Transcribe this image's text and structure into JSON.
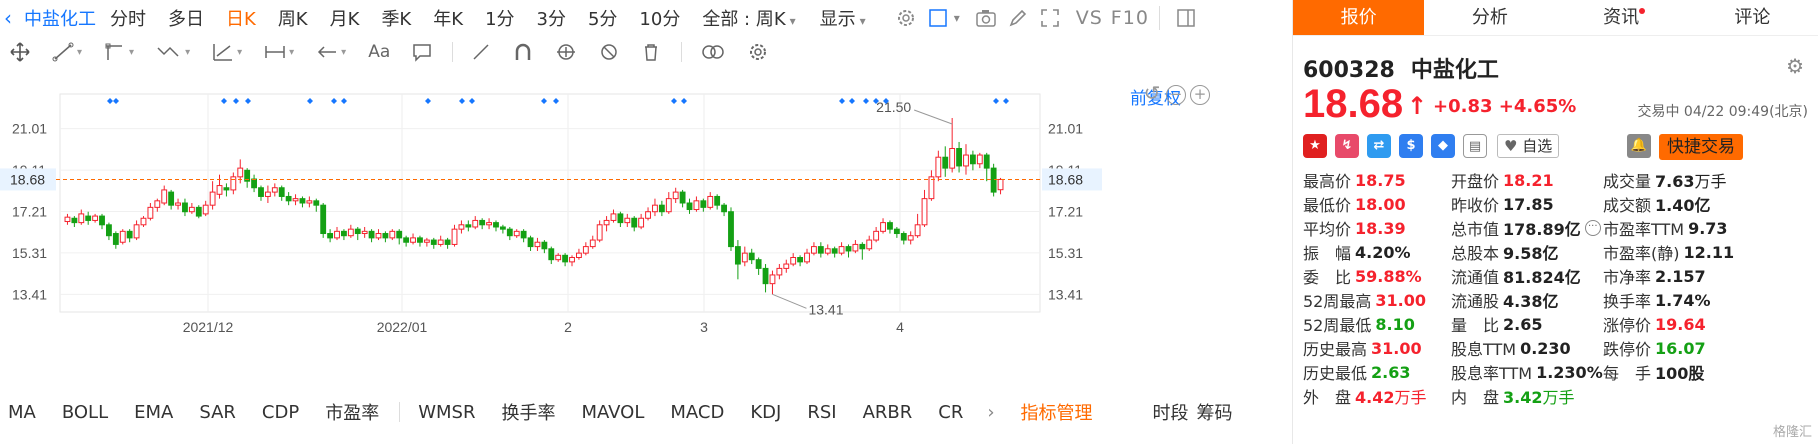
{
  "toolbar": {
    "stock_name": "中盐化工",
    "periods": [
      "分时",
      "多日",
      "日K",
      "周K",
      "月K",
      "季K",
      "年K",
      "1分",
      "3分",
      "5分",
      "10分"
    ],
    "active_period": "日K",
    "range_select": "全部 : 周K",
    "display_label": "显示",
    "vs_label": "VS",
    "f10_label": "F10"
  },
  "chart": {
    "adjust_label": "前复权",
    "current_price_label": "18.68",
    "y_ticks": [
      "21.01",
      "19.11",
      "18.68",
      "17.21",
      "15.31",
      "13.41"
    ],
    "x_labels": [
      "2021/12",
      "2022/01",
      "2",
      "3",
      "4"
    ],
    "max_annotation": "21.50",
    "min_annotation": "13.41",
    "colors": {
      "up": "#f5222d",
      "down": "#14a014",
      "marker": "#1677ff",
      "price_line": "#ff6a00"
    }
  },
  "chart_data": {
    "type": "candlestick",
    "ylim": [
      12.6,
      22.6
    ],
    "x_labels": [
      "2021/12",
      "2022/01",
      "2",
      "3",
      "4"
    ],
    "candles": [
      [
        16.75,
        16.95,
        16.6,
        17.1
      ],
      [
        16.9,
        16.7,
        16.5,
        17.0
      ],
      [
        16.7,
        17.1,
        16.6,
        17.3
      ],
      [
        17.0,
        16.8,
        16.6,
        17.2
      ],
      [
        16.8,
        17.0,
        16.7,
        17.1
      ],
      [
        17.0,
        16.6,
        16.4,
        17.1
      ],
      [
        16.6,
        16.1,
        15.9,
        16.7
      ],
      [
        16.2,
        15.7,
        15.5,
        16.3
      ],
      [
        15.8,
        16.3,
        15.7,
        16.4
      ],
      [
        16.3,
        16.0,
        15.8,
        16.4
      ],
      [
        16.0,
        16.6,
        15.9,
        16.8
      ],
      [
        16.6,
        16.9,
        16.5,
        17.0
      ],
      [
        16.9,
        17.4,
        16.8,
        17.6
      ],
      [
        17.4,
        17.7,
        17.2,
        17.8
      ],
      [
        17.6,
        18.2,
        17.5,
        18.4
      ],
      [
        18.1,
        17.5,
        17.3,
        18.2
      ],
      [
        17.5,
        17.6,
        17.3,
        17.8
      ],
      [
        17.6,
        17.2,
        17.0,
        17.8
      ],
      [
        17.2,
        17.4,
        17.1,
        17.6
      ],
      [
        17.4,
        17.0,
        16.9,
        17.5
      ],
      [
        17.1,
        17.5,
        17.0,
        17.7
      ],
      [
        17.5,
        18.1,
        17.3,
        18.6
      ],
      [
        18.0,
        18.4,
        17.8,
        18.9
      ],
      [
        18.3,
        18.2,
        17.9,
        18.5
      ],
      [
        18.2,
        18.8,
        18.0,
        19.0
      ],
      [
        18.8,
        19.2,
        18.5,
        19.6
      ],
      [
        19.1,
        18.6,
        18.3,
        19.2
      ],
      [
        18.7,
        18.3,
        18.1,
        18.9
      ],
      [
        18.3,
        17.9,
        17.7,
        18.4
      ],
      [
        17.9,
        18.1,
        17.6,
        18.4
      ],
      [
        18.1,
        18.3,
        17.9,
        18.5
      ],
      [
        18.3,
        17.9,
        17.7,
        18.4
      ],
      [
        17.9,
        17.7,
        17.5,
        18.1
      ],
      [
        17.7,
        17.8,
        17.5,
        18.0
      ],
      [
        17.8,
        17.6,
        17.4,
        17.9
      ],
      [
        17.6,
        17.7,
        17.4,
        17.9
      ],
      [
        17.7,
        17.5,
        17.2,
        17.8
      ],
      [
        17.5,
        16.2,
        16.0,
        17.6
      ],
      [
        16.2,
        16.0,
        15.8,
        16.4
      ],
      [
        16.0,
        16.3,
        15.9,
        16.5
      ],
      [
        16.3,
        16.1,
        15.9,
        16.4
      ],
      [
        16.1,
        16.4,
        16.0,
        16.6
      ],
      [
        16.4,
        16.2,
        15.9,
        16.5
      ],
      [
        16.2,
        16.3,
        16.0,
        16.5
      ],
      [
        16.3,
        16.0,
        15.8,
        16.4
      ],
      [
        16.0,
        16.2,
        15.9,
        16.4
      ],
      [
        16.2,
        16.0,
        15.8,
        16.3
      ],
      [
        16.0,
        16.3,
        15.9,
        16.4
      ],
      [
        16.3,
        16.0,
        15.7,
        16.4
      ],
      [
        16.0,
        15.8,
        15.6,
        16.1
      ],
      [
        15.8,
        16.0,
        15.7,
        16.2
      ],
      [
        16.0,
        15.8,
        15.6,
        16.1
      ],
      [
        15.8,
        15.9,
        15.6,
        16.0
      ],
      [
        15.9,
        15.7,
        15.5,
        16.0
      ],
      [
        15.7,
        15.9,
        15.6,
        16.1
      ],
      [
        15.9,
        15.7,
        15.5,
        16.0
      ],
      [
        15.7,
        16.4,
        15.6,
        16.6
      ],
      [
        16.4,
        16.6,
        16.2,
        16.8
      ],
      [
        16.6,
        16.5,
        16.3,
        16.8
      ],
      [
        16.5,
        16.8,
        16.4,
        17.0
      ],
      [
        16.8,
        16.6,
        16.4,
        16.9
      ],
      [
        16.6,
        16.7,
        16.4,
        16.9
      ],
      [
        16.7,
        16.5,
        16.3,
        16.8
      ],
      [
        16.5,
        16.4,
        16.2,
        16.6
      ],
      [
        16.4,
        16.1,
        15.9,
        16.5
      ],
      [
        16.1,
        16.3,
        16.0,
        16.4
      ],
      [
        16.3,
        16.0,
        15.8,
        16.4
      ],
      [
        16.0,
        15.6,
        15.4,
        16.1
      ],
      [
        15.6,
        15.8,
        15.4,
        16.0
      ],
      [
        15.8,
        15.5,
        15.3,
        15.9
      ],
      [
        15.5,
        15.0,
        14.8,
        15.6
      ],
      [
        15.0,
        15.2,
        14.9,
        15.3
      ],
      [
        15.2,
        14.9,
        14.7,
        15.3
      ],
      [
        14.9,
        15.1,
        14.7,
        15.2
      ],
      [
        15.1,
        15.3,
        15.0,
        15.5
      ],
      [
        15.3,
        15.6,
        15.2,
        15.8
      ],
      [
        15.6,
        15.9,
        15.5,
        16.1
      ],
      [
        15.9,
        16.6,
        15.8,
        16.8
      ],
      [
        16.6,
        16.8,
        16.3,
        17.0
      ],
      [
        16.8,
        17.1,
        16.7,
        17.3
      ],
      [
        17.1,
        16.7,
        16.5,
        17.2
      ],
      [
        16.7,
        16.9,
        16.5,
        17.1
      ],
      [
        16.9,
        16.5,
        16.3,
        17.0
      ],
      [
        16.5,
        16.9,
        16.4,
        17.1
      ],
      [
        16.9,
        17.2,
        16.8,
        17.4
      ],
      [
        17.2,
        17.5,
        17.0,
        17.8
      ],
      [
        17.5,
        17.2,
        17.0,
        17.7
      ],
      [
        17.2,
        17.8,
        17.1,
        18.1
      ],
      [
        17.8,
        18.1,
        17.6,
        18.3
      ],
      [
        18.1,
        17.6,
        17.4,
        18.2
      ],
      [
        17.6,
        17.3,
        17.1,
        17.8
      ],
      [
        17.3,
        17.7,
        17.2,
        17.9
      ],
      [
        17.7,
        17.4,
        17.2,
        17.8
      ],
      [
        17.4,
        17.9,
        17.3,
        18.1
      ],
      [
        17.9,
        17.5,
        17.3,
        18.0
      ],
      [
        17.5,
        17.2,
        17.0,
        17.6
      ],
      [
        17.2,
        15.6,
        15.4,
        17.4
      ],
      [
        15.6,
        14.8,
        14.1,
        15.9
      ],
      [
        14.9,
        15.3,
        14.7,
        15.6
      ],
      [
        15.3,
        15.0,
        14.8,
        15.5
      ],
      [
        15.0,
        14.6,
        14.3,
        15.1
      ],
      [
        14.6,
        13.9,
        13.5,
        14.8
      ],
      [
        13.9,
        14.3,
        13.41,
        14.5
      ],
      [
        14.3,
        14.6,
        14.1,
        14.8
      ],
      [
        14.6,
        14.8,
        14.4,
        15.0
      ],
      [
        14.8,
        15.1,
        14.7,
        15.3
      ],
      [
        15.1,
        14.9,
        14.7,
        15.2
      ],
      [
        14.9,
        15.3,
        14.8,
        15.5
      ],
      [
        15.3,
        15.6,
        15.2,
        15.8
      ],
      [
        15.6,
        15.3,
        15.1,
        15.8
      ],
      [
        15.3,
        15.5,
        15.2,
        15.7
      ],
      [
        15.5,
        15.3,
        15.1,
        15.6
      ],
      [
        15.3,
        15.6,
        15.2,
        15.8
      ],
      [
        15.6,
        15.4,
        15.1,
        15.7
      ],
      [
        15.4,
        15.7,
        15.3,
        15.9
      ],
      [
        15.7,
        15.5,
        15.0,
        15.8
      ],
      [
        15.5,
        15.9,
        15.4,
        16.1
      ],
      [
        15.9,
        16.3,
        15.8,
        16.5
      ],
      [
        16.3,
        16.7,
        16.2,
        16.9
      ],
      [
        16.7,
        16.4,
        16.2,
        16.8
      ],
      [
        16.4,
        16.2,
        16.0,
        16.5
      ],
      [
        16.2,
        15.9,
        15.7,
        16.3
      ],
      [
        15.9,
        16.1,
        15.7,
        16.3
      ],
      [
        16.1,
        16.6,
        16.0,
        17.1
      ],
      [
        16.6,
        17.8,
        16.5,
        18.2
      ],
      [
        17.8,
        18.8,
        17.7,
        19.1
      ],
      [
        18.8,
        19.7,
        18.6,
        20.0
      ],
      [
        19.7,
        19.2,
        18.8,
        20.2
      ],
      [
        19.2,
        20.1,
        19.0,
        21.5
      ],
      [
        20.1,
        19.3,
        19.0,
        20.4
      ],
      [
        19.3,
        19.8,
        18.9,
        20.3
      ],
      [
        19.8,
        19.4,
        19.1,
        20.0
      ],
      [
        19.4,
        19.8,
        19.2,
        19.9
      ],
      [
        19.8,
        19.2,
        18.6,
        19.9
      ],
      [
        19.2,
        18.1,
        17.9,
        19.4
      ],
      [
        18.21,
        18.68,
        18.0,
        18.75
      ]
    ],
    "marker_dates_x": [
      110,
      116,
      224,
      236,
      248,
      310,
      334,
      344,
      428,
      462,
      472,
      544,
      556,
      674,
      684,
      842,
      852,
      866,
      876,
      886,
      996,
      1006
    ]
  },
  "drawtools": [
    "move",
    "line",
    "channel",
    "wave",
    "fib",
    "measure",
    "arrow",
    "text",
    "note",
    "pencil",
    "magnet",
    "ruler",
    "hide",
    "delete",
    "compare",
    "settings"
  ],
  "indicators": {
    "main": [
      "MA",
      "BOLL",
      "EMA",
      "SAR",
      "CDP",
      "市盈率"
    ],
    "sub": [
      "WMSR",
      "换手率",
      "MAVOL",
      "MACD",
      "KDJ",
      "RSI",
      "ARBR",
      "CR"
    ],
    "manager": "指标管理",
    "right": [
      "时段",
      "筹码"
    ]
  },
  "panel": {
    "tabs": [
      "报价",
      "分析",
      "资讯",
      "评论"
    ],
    "code": "600328",
    "name": "中盐化工",
    "price": "18.68",
    "change": "+0.83",
    "change_pct": "+4.65%",
    "status": "交易中 04/22 09:49(北京)",
    "watch": "自选",
    "fast_trade": "快捷交易",
    "stats": [
      [
        {
          "label": "最高价",
          "value": "18.75",
          "color": "red"
        },
        {
          "label": "开盘价",
          "value": "18.21",
          "color": "red"
        },
        {
          "label": "成交量",
          "value": "7.63",
          "unit": "万手",
          "color": "black"
        }
      ],
      [
        {
          "label": "最低价",
          "value": "18.00",
          "color": "red"
        },
        {
          "label": "昨收价",
          "value": "17.85",
          "color": "black"
        },
        {
          "label": "成交额",
          "value": "1.40亿",
          "color": "black"
        }
      ],
      [
        {
          "label": "平均价",
          "value": "18.39",
          "color": "red"
        },
        {
          "label": "总市值",
          "value": "178.89亿",
          "color": "black",
          "more": "···"
        },
        {
          "label": "市盈率TTM",
          "value": "9.73",
          "color": "black"
        }
      ],
      [
        {
          "label": "振　幅",
          "value": "4.20%",
          "color": "black"
        },
        {
          "label": "总股本",
          "value": "9.58亿",
          "color": "black"
        },
        {
          "label": "市盈率(静)",
          "value": "12.11",
          "color": "black"
        }
      ],
      [
        {
          "label": "委　比",
          "value": "59.88%",
          "color": "red"
        },
        {
          "label": "流通值",
          "value": "81.824亿",
          "color": "black"
        },
        {
          "label": "市净率",
          "value": "2.157",
          "color": "black"
        }
      ],
      [
        {
          "label": "52周最高",
          "value": "31.00",
          "color": "red"
        },
        {
          "label": "流通股",
          "value": "4.38亿",
          "color": "black"
        },
        {
          "label": "换手率",
          "value": "1.74%",
          "color": "black"
        }
      ],
      [
        {
          "label": "52周最低",
          "value": "8.10",
          "color": "green"
        },
        {
          "label": "量　比",
          "value": "2.65",
          "color": "black"
        },
        {
          "label": "涨停价",
          "value": "19.64",
          "color": "red"
        }
      ],
      [
        {
          "label": "历史最高",
          "value": "31.00",
          "color": "red"
        },
        {
          "label": "股息TTM",
          "value": "0.230",
          "color": "black"
        },
        {
          "label": "跌停价",
          "value": "16.07",
          "color": "green"
        }
      ],
      [
        {
          "label": "历史最低",
          "value": "2.63",
          "color": "green"
        },
        {
          "label": "股息率TTM",
          "value": "1.230%",
          "color": "black"
        },
        {
          "label": "每　手",
          "value": "100股",
          "color": "black"
        }
      ],
      [
        {
          "label": "外　盘",
          "value": "4.42",
          "unit": "万手",
          "color": "red"
        },
        {
          "label": "内　盘",
          "value": "3.42",
          "unit": "万手",
          "color": "green"
        },
        {
          "label": "",
          "value": "",
          "color": "black"
        }
      ]
    ],
    "watermark": "格隆汇"
  }
}
